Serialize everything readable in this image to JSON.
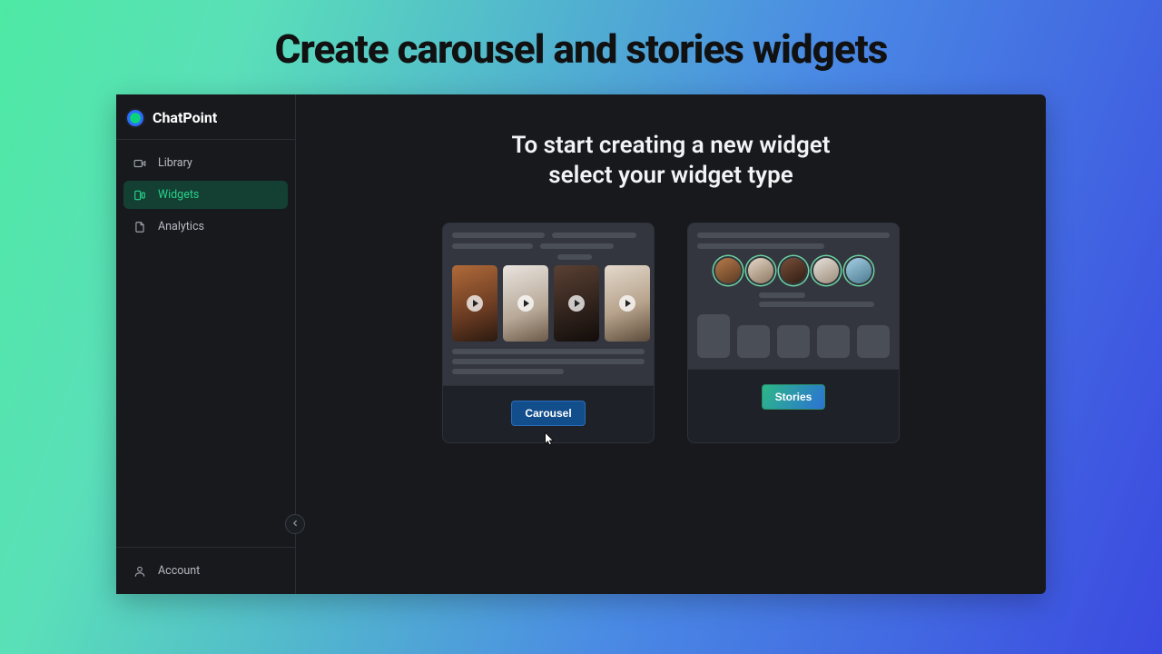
{
  "headline": "Create carousel and stories widgets",
  "brand": {
    "name": "ChatPoint"
  },
  "sidebar": {
    "items": [
      {
        "label": "Library",
        "icon": "camera-icon"
      },
      {
        "label": "Widgets",
        "icon": "widget-icon",
        "active": true
      },
      {
        "label": "Analytics",
        "icon": "file-icon"
      }
    ],
    "account_label": "Account"
  },
  "main": {
    "title_line1": "To start creating a new widget",
    "title_line2": "select your widget type",
    "cards": {
      "carousel": {
        "button": "Carousel"
      },
      "stories": {
        "button": "Stories"
      }
    }
  }
}
